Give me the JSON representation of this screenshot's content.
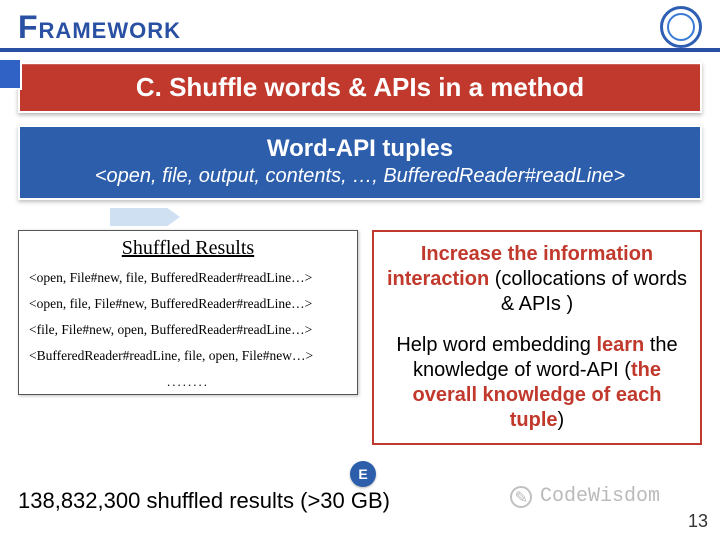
{
  "title": "Framework",
  "section_title": "C. Shuffle words & APIs in a method",
  "tuples": {
    "heading": "Word-API tuples",
    "example": "<open, file, output, contents, …, BufferedReader#readLine>"
  },
  "shuffled": {
    "heading": "Shuffled Results",
    "rows": [
      "<open, File#new, file, BufferedReader#readLine…>",
      "<open, file, File#new, BufferedReader#readLine…>",
      "<file, File#new, open, BufferedReader#readLine…>",
      "<BufferedReader#readLine, file, open, File#new…>"
    ],
    "dots": "........"
  },
  "info": {
    "p1_red": "Increase the information interaction",
    "p1_rest": " (collocations of words & APIs )",
    "p2_a": "Help word embedding ",
    "p2_learn": "learn",
    "p2_b": " the knowledge of word-API (",
    "p2_red2": "the overall knowledge of each tuple",
    "p2_c": ")"
  },
  "badge": "E",
  "footer_count": "138,832,300 shuffled results (>30 GB)",
  "watermark": "CodeWisdom",
  "page_number": "13"
}
